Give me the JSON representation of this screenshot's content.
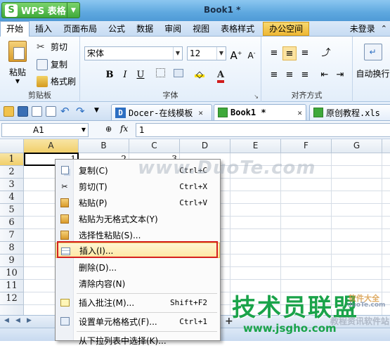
{
  "app": {
    "brand": "WPS 表格",
    "document_title": "Book1 *"
  },
  "menu": {
    "items": [
      "开始",
      "插入",
      "页面布局",
      "公式",
      "数据",
      "审阅",
      "视图",
      "表格样式",
      "办公空间"
    ],
    "active": "开始",
    "login": "未登录"
  },
  "ribbon": {
    "paste": "粘贴",
    "cut": "剪切",
    "copy": "复制",
    "format_painter": "格式刷",
    "clipboard_group": "剪贴板",
    "font_name": "宋体",
    "font_size": "12",
    "font_group": "字体",
    "align_group": "对齐方式",
    "wrap": "自动换行",
    "bold": "B",
    "italic": "I",
    "underline": "U",
    "grow": "A",
    "shrink": "A"
  },
  "tabs": [
    {
      "label": "Docer-在线模板",
      "active": false
    },
    {
      "label": "Book1 *",
      "active": true
    },
    {
      "label": "原创教程.xls",
      "active": false
    }
  ],
  "formula": {
    "cell_ref": "A1",
    "fx": "fx",
    "value": "1"
  },
  "grid": {
    "columns": [
      "A",
      "B",
      "C",
      "D",
      "E",
      "F",
      "G"
    ],
    "rows": [
      "1",
      "2",
      "3",
      "4",
      "5",
      "6",
      "7",
      "8",
      "9",
      "10",
      "11",
      "12"
    ],
    "row1_values": [
      "1",
      "2",
      "3"
    ]
  },
  "context_menu": {
    "items": [
      {
        "label": "复制(C)",
        "shortcut": "Ctrl+C",
        "icon": "copy-icon"
      },
      {
        "label": "剪切(T)",
        "shortcut": "Ctrl+X",
        "icon": "scissors-icon"
      },
      {
        "label": "粘贴(P)",
        "shortcut": "Ctrl+V",
        "icon": "paste-icon"
      },
      {
        "label": "粘贴为无格式文本(Y)",
        "shortcut": "",
        "icon": "paste-text-icon"
      },
      {
        "label": "选择性粘贴(S)...",
        "shortcut": "",
        "icon": "paste-special-icon"
      },
      {
        "label": "插入(I)...",
        "shortcut": "",
        "icon": "insert-icon"
      },
      {
        "label": "删除(D)...",
        "shortcut": "",
        "icon": ""
      },
      {
        "label": "清除内容(N)",
        "shortcut": "",
        "icon": ""
      },
      {
        "label": "插入批注(M)...",
        "shortcut": "Shift+F2",
        "icon": "comment-icon"
      },
      {
        "label": "设置单元格格式(F)...",
        "shortcut": "Ctrl+1",
        "icon": "format-cells-icon"
      },
      {
        "label": "从下拉列表中选择(K)...",
        "shortcut": "",
        "icon": ""
      }
    ],
    "highlighted": "插入(I)..."
  },
  "watermarks": {
    "dotce": "www.DuoTe.com",
    "jsgho_cn": "技术员联盟",
    "jsgho_url": "www.jsgho.com",
    "softbig": "软件大全",
    "teach": "教程资讯软件站",
    "duote_small": "duoTe.com"
  },
  "colors": {
    "accent": "#4f9ad6",
    "selection": "#f1cf6a",
    "highlight_box": "#d6201f",
    "watermark_green": "#1aa34a"
  }
}
